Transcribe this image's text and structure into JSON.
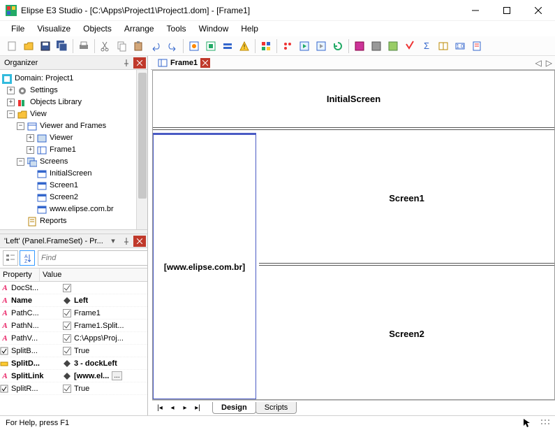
{
  "title": "Elipse E3 Studio  -  [C:\\Apps\\Project1\\Project1.dom] - [Frame1]",
  "menu": {
    "file": "File",
    "visualize": "Visualize",
    "objects": "Objects",
    "arrange": "Arrange",
    "tools": "Tools",
    "window": "Window",
    "help": "Help"
  },
  "organizer": {
    "title": "Organizer",
    "tree": {
      "root": "Domain: Project1",
      "settings": "Settings",
      "objects_library": "Objects Library",
      "view": "View",
      "viewer_and_frames": "Viewer and Frames",
      "viewer": "Viewer",
      "frame1": "Frame1",
      "screens": "Screens",
      "initial_screen": "InitialScreen",
      "screen1": "Screen1",
      "screen2": "Screen2",
      "elipse_url": "www.elipse.com.br",
      "reports": "Reports"
    }
  },
  "props_panel": {
    "title": "'Left' (Panel.FrameSet) - Pr...",
    "find_placeholder": "Find",
    "headers": {
      "property": "Property",
      "value": "Value"
    },
    "rows": [
      {
        "type": "A",
        "name": "DocSt...",
        "value": "",
        "check": true
      },
      {
        "type": "A",
        "name": "Name",
        "value": "Left",
        "diamond": true,
        "bold": true
      },
      {
        "type": "A",
        "name": "PathC...",
        "value": "Frame1",
        "check": true
      },
      {
        "type": "A",
        "name": "PathN...",
        "value": "Frame1.Split...",
        "check": true
      },
      {
        "type": "A",
        "name": "PathV...",
        "value": "C:\\Apps\\Proj...",
        "check": true
      },
      {
        "type": "B",
        "name": "SplitB...",
        "value": "True",
        "check": true
      },
      {
        "type": "S",
        "name": "SplitD...",
        "value": "3 - dockLeft",
        "diamond": true,
        "bold": true
      },
      {
        "type": "A",
        "name": "SplitLink",
        "value": "[www.el...",
        "diamond": true,
        "bold": true,
        "ellipsis": true
      },
      {
        "type": "B",
        "name": "SplitR...",
        "value": "True",
        "check": true
      }
    ]
  },
  "doc": {
    "tab": "Frame1",
    "frames": {
      "initial": "InitialScreen",
      "left": "[www.elipse.com.br]",
      "s1": "Screen1",
      "s2": "Screen2"
    },
    "bottom_tabs": {
      "design": "Design",
      "scripts": "Scripts"
    }
  },
  "status": "For Help, press F1",
  "chart_data": null
}
